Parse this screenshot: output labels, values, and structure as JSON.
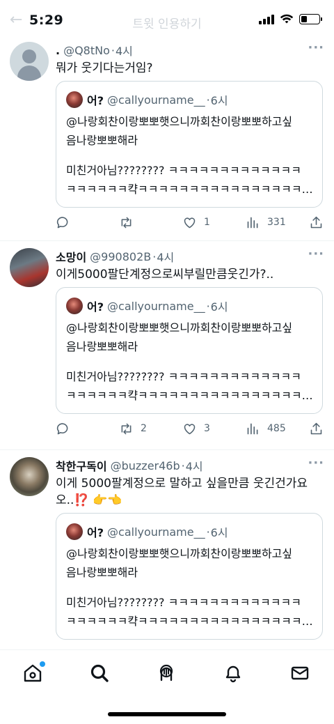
{
  "status_bar": {
    "time": "5:29",
    "battery_level": 0.35
  },
  "faded_header": "트윗 인용하기",
  "quoted_tweet": {
    "name": "어?",
    "handle": "@callyourname__",
    "time": "6시",
    "line1": "@나랑회찬이랑뽀뽀햇으니까회찬이랑뽀뽀하고싶",
    "line2": "음나랑뽀뽀해라",
    "line3": "미친거아님???????? ㅋㅋㅋㅋㅋㅋㅋㅋㅋㅋㅋㅋㅋ",
    "line4": "ㅋㅋㅋㅋㅋㅋ캭ㅋㅋㅋㅋㅋㅋㅋㅋㅋㅋㅋㅋㅋㅋㅋㅋㅋㅋㅋㅋ..."
  },
  "tweets": [
    {
      "name": ".",
      "handle": "@Q8tNo",
      "time_sep": "·",
      "time": "4시",
      "text": "뭐가 웃기다는거임?",
      "replies": "",
      "retweets": "",
      "likes": "1",
      "views": "331"
    },
    {
      "name": "소망이",
      "handle": "@990802B",
      "time_sep": "·",
      "time": "4시",
      "text": "이게5000팔단계정으로씨부릴만큼웃긴가?..",
      "replies": "",
      "retweets": "2",
      "likes": "3",
      "views": "485"
    },
    {
      "name": "착한구독이",
      "handle": "@buzzer46b",
      "time_sep": "·",
      "time": "4시",
      "text_line1": "이게 5000팔계정으로 말하고 싶을만큼 웃긴건가요",
      "text_line2": "오..⁉️ 👉👈"
    }
  ],
  "more_label": "···",
  "tabs": [
    "home",
    "search",
    "spaces",
    "notifications",
    "messages"
  ]
}
